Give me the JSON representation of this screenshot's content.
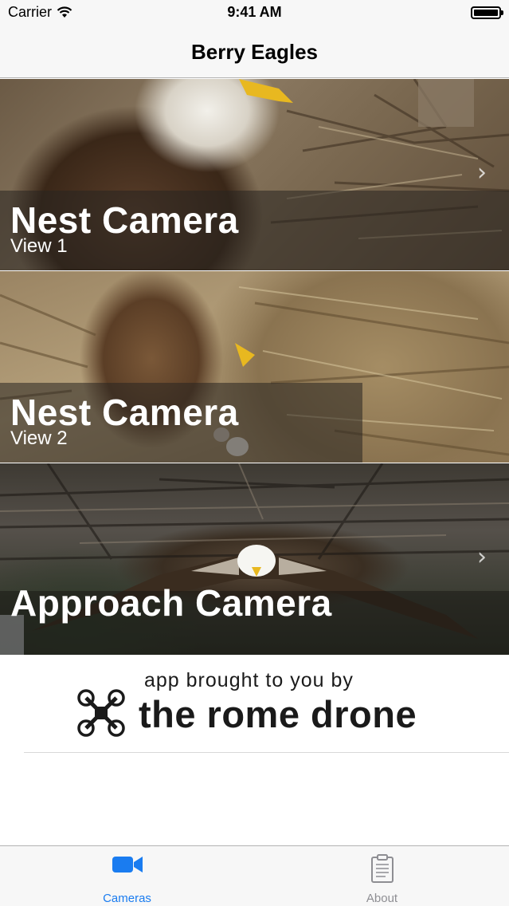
{
  "status_bar": {
    "carrier": "Carrier",
    "time": "9:41 AM"
  },
  "nav": {
    "title": "Berry Eagles"
  },
  "cameras": [
    {
      "title": "Nest Camera",
      "subtitle": "View 1"
    },
    {
      "title": "Nest Camera",
      "subtitle": "View 2"
    },
    {
      "title": "Approach Camera",
      "subtitle": ""
    }
  ],
  "sponsor": {
    "line1": "app brought to you by",
    "line2": "the rome drone"
  },
  "tabs": [
    {
      "label": "Cameras",
      "icon": "video-camera-icon",
      "selected": true
    },
    {
      "label": "About",
      "icon": "clipboard-icon",
      "selected": false
    }
  ],
  "colors": {
    "accent": "#1a7cf0",
    "inactive": "#8e8e93"
  }
}
